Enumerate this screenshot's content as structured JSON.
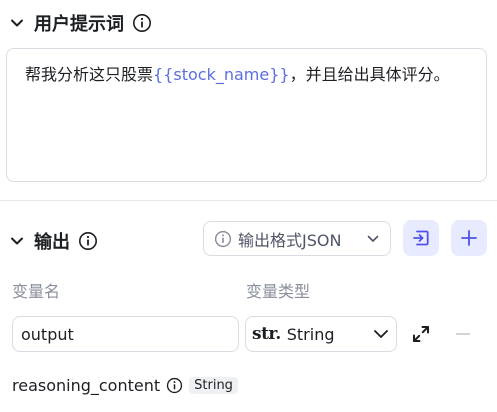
{
  "prompt_section": {
    "title": "用户提示词",
    "text_before": "帮我分析这只股票",
    "variable": "{{stock_name}}",
    "text_after": "，并且给出具体评分。"
  },
  "output_section": {
    "title": "输出",
    "format_label": "输出格式JSON",
    "columns": {
      "name": "变量名",
      "type": "变量类型"
    },
    "variables": [
      {
        "name": "output",
        "type_prefix": "str.",
        "type": "String"
      }
    ],
    "reasoning": {
      "name": "reasoning_content",
      "type": "String"
    }
  },
  "colors": {
    "accent": "#4d53e8",
    "accent_bg": "#e8ebff",
    "variable_text": "#5b6ee1",
    "muted_text": "#8a8f9c",
    "border": "#d9dce3"
  },
  "icons": {
    "collapse": "chevron-down-icon",
    "info": "info-icon",
    "import": "import-icon",
    "add": "plus-icon",
    "expand": "expand-icon",
    "remove": "minus-icon"
  }
}
